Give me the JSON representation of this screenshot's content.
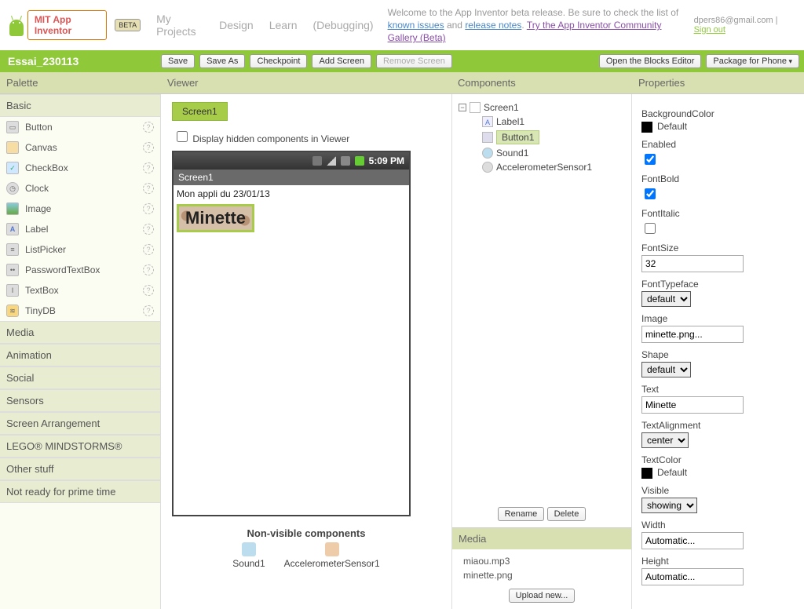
{
  "header": {
    "brand": "MIT App Inventor",
    "beta": "BETA",
    "nav": {
      "my_projects": "My Projects",
      "design": "Design",
      "learn": "Learn",
      "debugging": "(Debugging)"
    },
    "welcome_pre": "Welcome to the App Inventor beta release. Be sure to check the list of ",
    "welcome_known": "known issues",
    "welcome_and": " and ",
    "welcome_release": "release notes",
    "welcome_period": ". ",
    "welcome_try": "Try the App Inventor Community Gallery (Beta)",
    "user_email": "dpers86@gmail.com",
    "signout": "Sign out"
  },
  "project_name": "Essai_230113",
  "toolbar": {
    "save": "Save",
    "save_as": "Save As",
    "checkpoint": "Checkpoint",
    "add_screen": "Add Screen",
    "remove_screen": "Remove Screen",
    "blocks_editor": "Open the Blocks Editor",
    "package": "Package for Phone"
  },
  "panel_titles": {
    "palette": "Palette",
    "viewer": "Viewer",
    "components": "Components",
    "properties": "Properties",
    "media": "Media"
  },
  "palette": {
    "basic": "Basic",
    "items": [
      {
        "label": "Button"
      },
      {
        "label": "Canvas"
      },
      {
        "label": "CheckBox"
      },
      {
        "label": "Clock"
      },
      {
        "label": "Image"
      },
      {
        "label": "Label"
      },
      {
        "label": "ListPicker"
      },
      {
        "label": "PasswordTextBox"
      },
      {
        "label": "TextBox"
      },
      {
        "label": "TinyDB"
      }
    ],
    "sections": [
      "Media",
      "Animation",
      "Social",
      "Sensors",
      "Screen Arrangement",
      "LEGO® MINDSTORMS®",
      "Other stuff",
      "Not ready for prime time"
    ]
  },
  "viewer": {
    "screen_tab": "Screen1",
    "show_hidden": "Display hidden components in Viewer",
    "clock": "5:09 PM",
    "screen_title": "Screen1",
    "label_text": "Mon appli du 23/01/13",
    "button_text": "Minette",
    "nonvis_title": "Non-visible components",
    "nonvis": [
      "Sound1",
      "AccelerometerSensor1"
    ]
  },
  "components": {
    "root": "Screen1",
    "children": [
      {
        "name": "Label1"
      },
      {
        "name": "Button1",
        "selected": true
      },
      {
        "name": "Sound1"
      },
      {
        "name": "AccelerometerSensor1"
      }
    ],
    "rename": "Rename",
    "delete": "Delete"
  },
  "media": {
    "files": [
      "miaou.mp3",
      "minette.png"
    ],
    "upload": "Upload new..."
  },
  "properties": {
    "BackgroundColor": {
      "label": "BackgroundColor",
      "value": "Default",
      "swatch": "#000000"
    },
    "Enabled": {
      "label": "Enabled",
      "checked": true
    },
    "FontBold": {
      "label": "FontBold",
      "checked": true
    },
    "FontItalic": {
      "label": "FontItalic",
      "checked": false
    },
    "FontSize": {
      "label": "FontSize",
      "value": "32"
    },
    "FontTypeface": {
      "label": "FontTypeface",
      "value": "default"
    },
    "Image": {
      "label": "Image",
      "value": "minette.png..."
    },
    "Shape": {
      "label": "Shape",
      "value": "default"
    },
    "Text": {
      "label": "Text",
      "value": "Minette"
    },
    "TextAlignment": {
      "label": "TextAlignment",
      "value": "center"
    },
    "TextColor": {
      "label": "TextColor",
      "value": "Default",
      "swatch": "#000000"
    },
    "Visible": {
      "label": "Visible",
      "value": "showing"
    },
    "Width": {
      "label": "Width",
      "value": "Automatic..."
    },
    "Height": {
      "label": "Height",
      "value": "Automatic..."
    }
  }
}
